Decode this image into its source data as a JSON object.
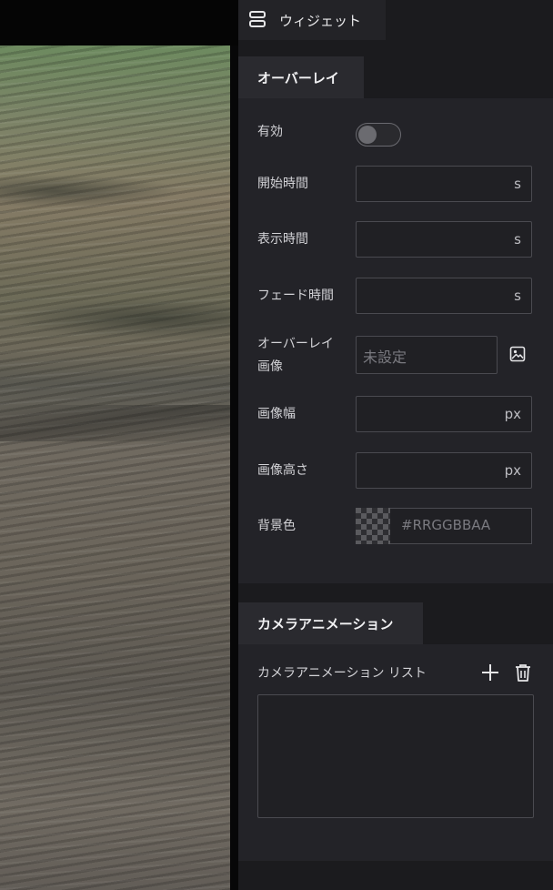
{
  "panel": {
    "widget_tab": {
      "label": "ウィジェット",
      "icon": "widget-icon"
    }
  },
  "overlay": {
    "tab_label": "オーバーレイ",
    "enabled": {
      "label": "有効",
      "value": false
    },
    "start_time": {
      "label": "開始時間",
      "unit": "s",
      "value": ""
    },
    "display_time": {
      "label": "表示時間",
      "unit": "s",
      "value": ""
    },
    "fade_time": {
      "label": "フェード時間",
      "unit": "s",
      "value": ""
    },
    "overlay_image": {
      "label_line1": "オーバーレイ",
      "label_line2": "画像",
      "placeholder": "未設定",
      "icon": "image-icon"
    },
    "image_width": {
      "label": "画像幅",
      "unit": "px",
      "value": ""
    },
    "image_height": {
      "label": "画像高さ",
      "unit": "px",
      "value": ""
    },
    "background_color": {
      "label": "背景色",
      "placeholder": "#RRGGBBAA"
    }
  },
  "camera_animation": {
    "tab_label": "カメラアニメーション",
    "list_label": "カメラアニメーション リスト",
    "add_icon": "plus-icon",
    "delete_icon": "trash-icon",
    "items": []
  },
  "colors": {
    "panel_bg": "#1b1b1e",
    "section_bg": "#232328",
    "border": "#4a4a50"
  }
}
